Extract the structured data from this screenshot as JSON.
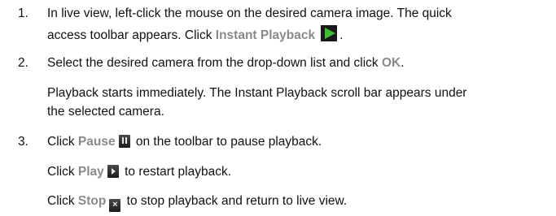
{
  "steps": [
    {
      "number": "1.",
      "line1": "In live view, left-click the mouse on the desired camera image. The quick",
      "line2_before": "access toolbar appears. Click ",
      "keyword": "Instant Playback",
      "icon": "instant-playback-icon",
      "line2_after": "."
    },
    {
      "number": "2.",
      "line1_before": "Select the desired camera from the drop-down list and click ",
      "keyword": "OK",
      "line1_after": ".",
      "note_line1": "Playback starts immediately. The Instant Playback scroll bar appears under",
      "note_line2": "the selected camera."
    },
    {
      "number": "3.",
      "pause": {
        "before": "Click ",
        "keyword": "Pause",
        "icon": "pause-icon",
        "after": "on the toolbar to pause playback."
      },
      "play": {
        "before": "Click ",
        "keyword": "Play",
        "icon": "play-icon",
        "after": "to restart playback."
      },
      "stop": {
        "before": "Click ",
        "keyword": "Stop",
        "icon": "stop-icon",
        "icon_glyph": "×",
        "after": "to stop playback and return to live view."
      }
    }
  ],
  "colors": {
    "keyword": "#8a8a8a",
    "text": "#111111",
    "play_green": "#3fbf2f"
  }
}
